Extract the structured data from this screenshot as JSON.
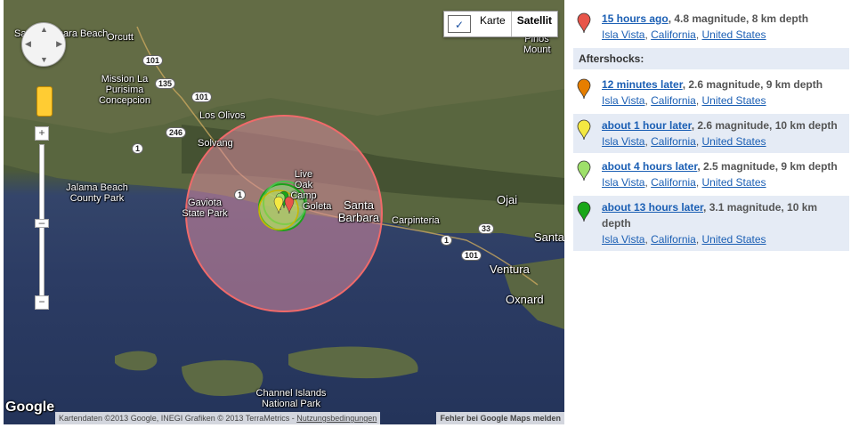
{
  "map": {
    "controls": {
      "map_type": "Karte",
      "satellite": "Satellit",
      "zoom_in": "+",
      "zoom_out": "−"
    },
    "places": {
      "santa_barbara_beach": "Santa Barbara Beach",
      "orcutt": "Orcutt",
      "mission_la_purisima": "Mission La Purisima Concepcion",
      "los_olivos": "Los Olivos",
      "solvang": "Solvang",
      "jalama_beach": "Jalama Beach County Park",
      "gaviota": "Gaviota State Park",
      "live_oak_camp": "Live Oak Camp",
      "goleta": "Goleta",
      "santa_barbara": "Santa Barbara",
      "carpinteria": "Carpinteria",
      "ojai": "Ojai",
      "santa_paula": "Santa",
      "ventura": "Ventura",
      "oxnard": "Oxnard",
      "pinos_mount": "Pinos Mount",
      "channel_islands": "Channel Islands National Park"
    },
    "shields": {
      "r101a": "101",
      "r135": "135",
      "r101b": "101",
      "r246": "246",
      "r1a": "1",
      "r1b": "1",
      "r154": "1",
      "r1c": "1",
      "r33": "33",
      "r101c": "101",
      "r101d": "101"
    },
    "google_logo": "Google",
    "attribution": "Kartendaten ©2013 Google, INEGI Grafiken © 2013 TerraMetrics - ",
    "terms_link": "Nutzungsbedingungen",
    "report_link": "Fehler bei Google Maps melden"
  },
  "main_quake": {
    "when": "15 hours ago",
    "details": ", 4.8 magnitude, 8 km depth",
    "place": "Isla Vista",
    "state": "California",
    "country": "United States",
    "pin_color": "#e8554a"
  },
  "aftershocks_header": "Aftershocks:",
  "aftershocks": [
    {
      "when": "12 minutes later",
      "details": ", 2.6 magnitude, 9 km depth",
      "place": "Isla Vista",
      "state": "California",
      "country": "United States",
      "pin_color": "#e67e00"
    },
    {
      "when": "about 1 hour later",
      "details": ", 2.6 magnitude, 10 km depth",
      "place": "Isla Vista",
      "state": "California",
      "country": "United States",
      "pin_color": "#f4e842"
    },
    {
      "when": "about 4 hours later",
      "details": ", 2.5 magnitude, 9 km depth",
      "place": "Isla Vista",
      "state": "California",
      "country": "United States",
      "pin_color": "#9ee06a"
    },
    {
      "when": "about 13 hours later",
      "details": ", 3.1 magnitude, 10 km depth",
      "place": "Isla Vista",
      "state": "California",
      "country": "United States",
      "pin_color": "#19a719"
    }
  ]
}
